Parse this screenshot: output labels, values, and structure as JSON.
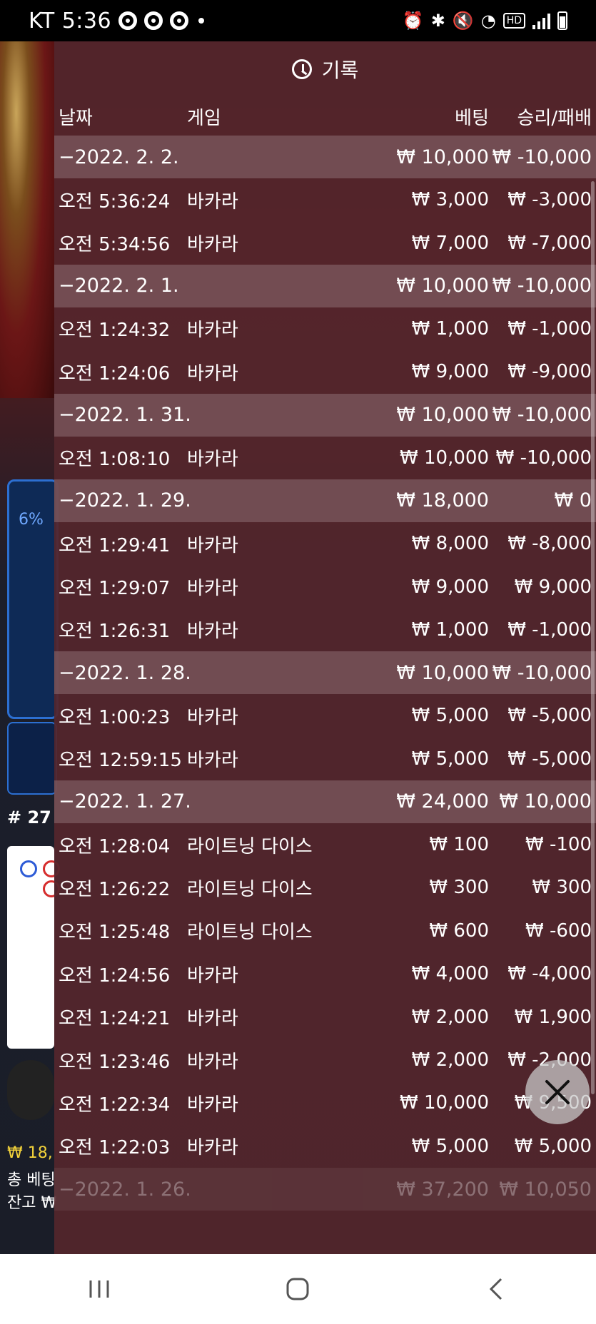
{
  "status_bar": {
    "carrier": "KT",
    "time": "5:36",
    "hd_badge": "HD"
  },
  "background": {
    "progress_pct": "6%",
    "round_label": "# 27",
    "balance": "₩ 18,",
    "total_bet": "총 베팅",
    "remaining": "잔고 ₩"
  },
  "panel": {
    "title": "기록",
    "headers": {
      "date": "날짜",
      "game": "게임",
      "bet": "베팅",
      "result": "승리/패배"
    }
  },
  "groups": [
    {
      "date": "−2022. 2. 2.",
      "bet": "₩ 10,000",
      "result": "₩ -10,000",
      "items": [
        {
          "time": "오전 5:36:24",
          "game": "바카라",
          "bet": "₩ 3,000",
          "result": "₩ -3,000"
        },
        {
          "time": "오전 5:34:56",
          "game": "바카라",
          "bet": "₩ 7,000",
          "result": "₩ -7,000"
        }
      ]
    },
    {
      "date": "−2022. 2. 1.",
      "bet": "₩ 10,000",
      "result": "₩ -10,000",
      "items": [
        {
          "time": "오전 1:24:32",
          "game": "바카라",
          "bet": "₩ 1,000",
          "result": "₩ -1,000"
        },
        {
          "time": "오전 1:24:06",
          "game": "바카라",
          "bet": "₩ 9,000",
          "result": "₩ -9,000"
        }
      ]
    },
    {
      "date": "−2022. 1. 31.",
      "bet": "₩ 10,000",
      "result": "₩ -10,000",
      "items": [
        {
          "time": "오전 1:08:10",
          "game": "바카라",
          "bet": "₩ 10,000",
          "result": "₩ -10,000"
        }
      ]
    },
    {
      "date": "−2022. 1. 29.",
      "bet": "₩ 18,000",
      "result": "₩ 0",
      "items": [
        {
          "time": "오전 1:29:41",
          "game": "바카라",
          "bet": "₩ 8,000",
          "result": "₩ -8,000"
        },
        {
          "time": "오전 1:29:07",
          "game": "바카라",
          "bet": "₩ 9,000",
          "result": "₩ 9,000"
        },
        {
          "time": "오전 1:26:31",
          "game": "바카라",
          "bet": "₩ 1,000",
          "result": "₩ -1,000"
        }
      ]
    },
    {
      "date": "−2022. 1. 28.",
      "bet": "₩ 10,000",
      "result": "₩ -10,000",
      "items": [
        {
          "time": "오전 1:00:23",
          "game": "바카라",
          "bet": "₩ 5,000",
          "result": "₩ -5,000"
        },
        {
          "time": "오전 12:59:15",
          "game": "바카라",
          "bet": "₩ 5,000",
          "result": "₩ -5,000"
        }
      ]
    },
    {
      "date": "−2022. 1. 27.",
      "bet": "₩ 24,000",
      "result": "₩ 10,000",
      "items": [
        {
          "time": "오전 1:28:04",
          "game": "라이트닝 다이스",
          "bet": "₩ 100",
          "result": "₩ -100"
        },
        {
          "time": "오전 1:26:22",
          "game": "라이트닝 다이스",
          "bet": "₩ 300",
          "result": "₩ 300"
        },
        {
          "time": "오전 1:25:48",
          "game": "라이트닝 다이스",
          "bet": "₩ 600",
          "result": "₩ -600"
        },
        {
          "time": "오전 1:24:56",
          "game": "바카라",
          "bet": "₩ 4,000",
          "result": "₩ -4,000"
        },
        {
          "time": "오전 1:24:21",
          "game": "바카라",
          "bet": "₩ 2,000",
          "result": "₩ 1,900"
        },
        {
          "time": "오전 1:23:46",
          "game": "바카라",
          "bet": "₩ 2,000",
          "result": "₩ -2,000"
        },
        {
          "time": "오전 1:22:34",
          "game": "바카라",
          "bet": "₩ 10,000",
          "result": "₩ 9,500"
        },
        {
          "time": "오전 1:22:03",
          "game": "바카라",
          "bet": "₩ 5,000",
          "result": "₩ 5,000"
        }
      ]
    },
    {
      "date": "−2022. 1. 26.",
      "bet": "₩ 37,200",
      "result": "₩ 10,050",
      "items": []
    }
  ]
}
